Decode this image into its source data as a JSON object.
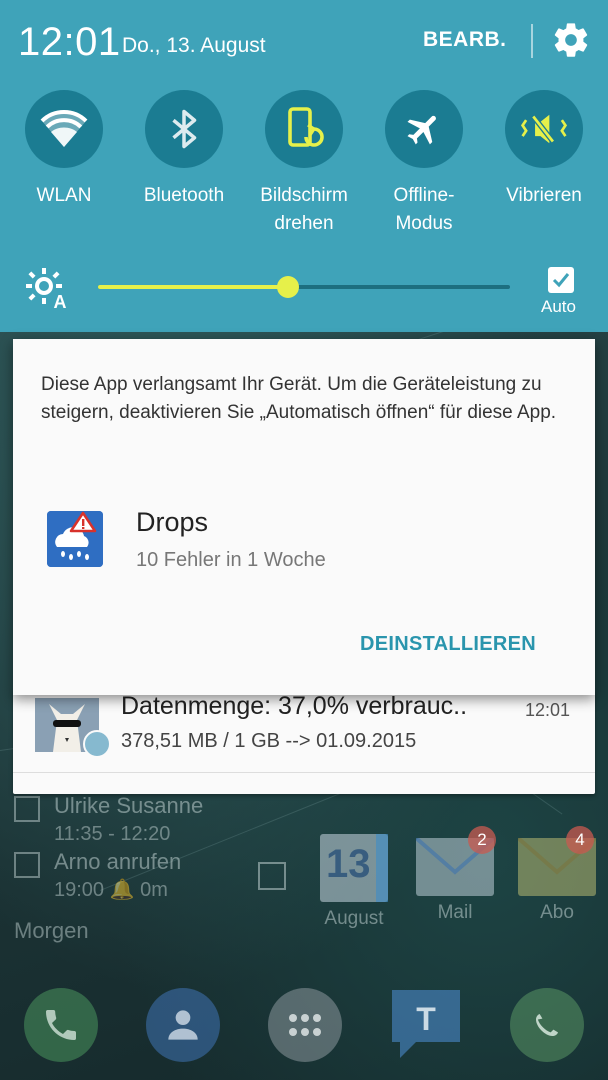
{
  "status": {
    "time": "12:01",
    "date": "Do., 13. August",
    "edit_label": "BEARB."
  },
  "quick_settings": [
    {
      "label": "WLAN",
      "icon": "wifi-icon"
    },
    {
      "label": "Bluetooth",
      "icon": "bluetooth-icon"
    },
    {
      "label": "Bildschirm\ndrehen",
      "icon": "screen-rotate-icon"
    },
    {
      "label": "Offline-\nModus",
      "icon": "airplane-icon"
    },
    {
      "label": "Vibrieren",
      "icon": "vibrate-icon"
    }
  ],
  "brightness": {
    "level": 0.46,
    "auto_label": "Auto",
    "auto_checked": true
  },
  "dialog": {
    "message": "Diese App verlangsamt Ihr Gerät. Um die Geräteleistung zu steigern, deaktivieren Sie „Automatisch öffnen“ für diese App.",
    "app_name": "Drops",
    "app_detail": "10 Fehler in 1 Woche",
    "uninstall_label": "DEINSTALLIEREN"
  },
  "notification": {
    "title": "Datenmenge: 37,0% verbrauc..",
    "time": "12:01",
    "subtitle": "378,51 MB / 1 GB --> 01.09.2015"
  },
  "home": {
    "calendar_items": [
      {
        "title": "Ulrike Susanne",
        "time": "11:35 - 12:20"
      },
      {
        "title": "Arno anrufen",
        "time": "19:00 🔔 0m"
      }
    ],
    "morgen_label": "Morgen",
    "calendar_icon": {
      "day": "13",
      "label": "August"
    },
    "mail_icon": {
      "label": "Mail",
      "badge": "2"
    },
    "abo_icon": {
      "label": "Abo",
      "badge": "4"
    }
  },
  "colors": {
    "shade": "#3fa3b9",
    "toggle": "#1b7c92",
    "accent": "#e6f04a",
    "link": "#2a95ad"
  }
}
